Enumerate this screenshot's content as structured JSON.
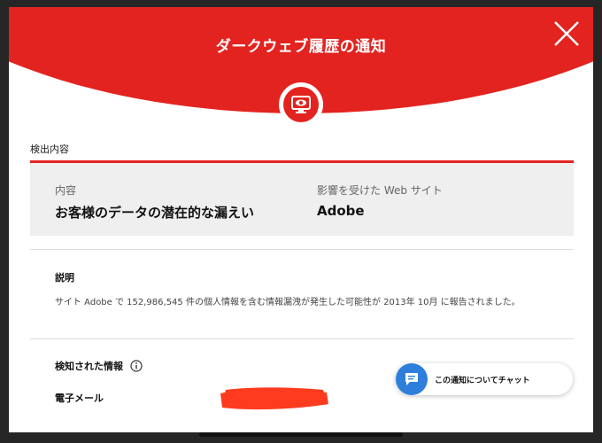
{
  "modal": {
    "title": "ダークウェブ履歴の通知",
    "close_icon": "close-icon",
    "badge_icon": "monitor-eye-icon"
  },
  "detection": {
    "section_label": "検出内容",
    "content_label": "内容",
    "content_value": "お客様のデータの潜在的な漏えい",
    "site_label": "影響を受けた Web サイト",
    "site_value": "Adobe"
  },
  "description": {
    "title": "説明",
    "text": "サイト Adobe で 152,986,545 件の個人情報を含む情報漏洩が発生した可能性が 2013年 10月 に報告されました。"
  },
  "detected_info": {
    "title": "検知された情報",
    "info_icon": "info-icon",
    "email_label": "電子メール"
  },
  "chat": {
    "label": "この通知についてチャット",
    "icon": "chat-bubble-icon"
  },
  "colors": {
    "brand_red": "#e3231f",
    "chat_blue": "#2e7fdc",
    "redaction": "#ff3b1f"
  }
}
